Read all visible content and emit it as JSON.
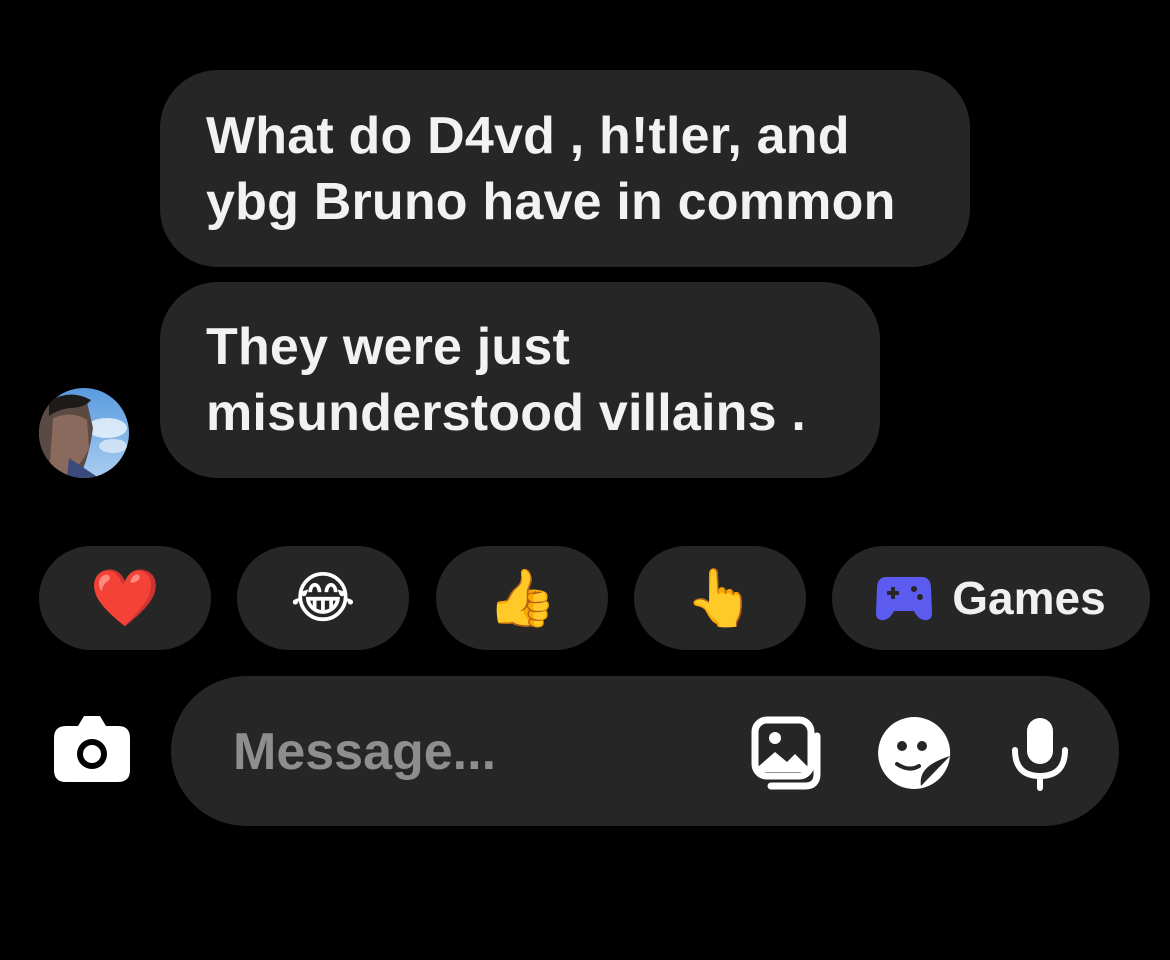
{
  "conversation": {
    "messages": [
      {
        "text": "What do D4vd , h!tler, and\nybg Bruno have in common"
      },
      {
        "text": "They were just\nmisunderstood villains ."
      }
    ]
  },
  "quick_reactions": [
    {
      "emoji": "❤️",
      "icon": "heart-icon"
    },
    {
      "emoji": "😂",
      "icon": "tears-of-joy-icon"
    },
    {
      "emoji": "👍",
      "icon": "thumbs-up-icon"
    },
    {
      "emoji": "👆",
      "icon": "pointing-hand-icon"
    }
  ],
  "games": {
    "label": "Games",
    "icon": "game-controller-icon",
    "color": "#5b5bf0"
  },
  "composer": {
    "placeholder": "Message...",
    "icons": [
      "camera-icon",
      "gallery-icon",
      "sticker-icon",
      "microphone-icon"
    ]
  },
  "colors": {
    "background": "#000000",
    "bubble": "#262626",
    "text": "#f2f2f2",
    "placeholder": "#8e8e8e"
  }
}
